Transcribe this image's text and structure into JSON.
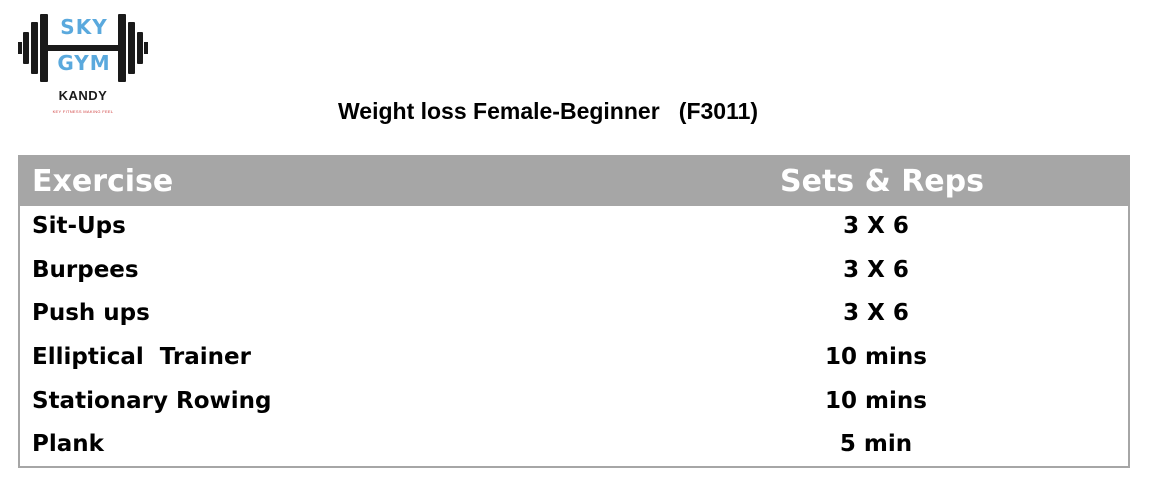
{
  "logo": {
    "line1": "SKY",
    "line2": "GYM",
    "city": "KANDY",
    "tagline": "KEY FITNESS MAKING FEEL",
    "colors": {
      "text": "#5aa9dd",
      "barbell": "#1a1a1a",
      "tagline": "#d04040"
    }
  },
  "title": "Weight loss Female-Beginner   (F3011)",
  "table": {
    "header_color": "#a6a6a6",
    "columns": [
      "Exercise",
      "Sets & Reps"
    ],
    "rows": [
      {
        "exercise": "Sit-Ups",
        "sets_reps": "3 X 6"
      },
      {
        "exercise": "Burpees",
        "sets_reps": "3 X 6"
      },
      {
        "exercise": "Push ups",
        "sets_reps": "3 X 6"
      },
      {
        "exercise": "Elliptical  Trainer",
        "sets_reps": "10 mins"
      },
      {
        "exercise": "Stationary Rowing",
        "sets_reps": "10 mins"
      },
      {
        "exercise": "Plank",
        "sets_reps": "5 min"
      }
    ]
  }
}
